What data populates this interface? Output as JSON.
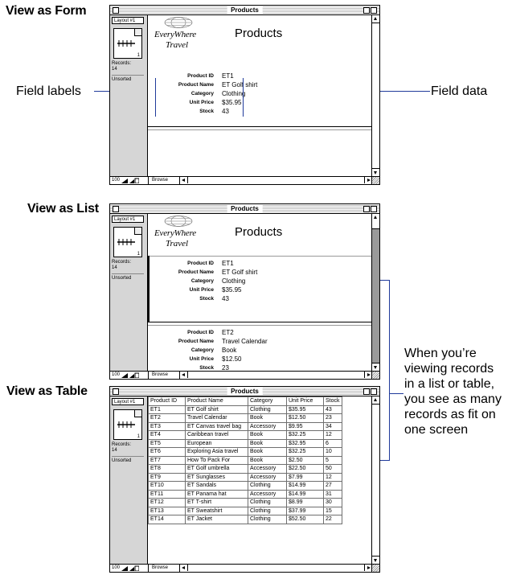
{
  "sections": [
    {
      "heading": "View as Form"
    },
    {
      "heading": "View as List"
    },
    {
      "heading": "View as Table"
    }
  ],
  "callouts": {
    "field_labels": "Field labels",
    "field_data": "Field data",
    "records_note": [
      "When you’re",
      "viewing records",
      "in a list or table,",
      "you see as many",
      "records as fit on",
      "one screen"
    ]
  },
  "window": {
    "title": "Products",
    "layout_popup": "Layout #1",
    "book_page": "1",
    "records_label": "Records:",
    "records_count": "14",
    "sort_status": "Unsorted",
    "zoom_level": "100",
    "mode": "Browse"
  },
  "layout": {
    "logo_line1": "EveryWhere",
    "logo_line2": "Travel",
    "title": "Products"
  },
  "fields": {
    "labels": [
      "Product ID",
      "Product Name",
      "Category",
      "Unit Price",
      "Stock"
    ]
  },
  "records": [
    {
      "id": "ET1",
      "name": "ET Golf shirt",
      "category": "Clothing",
      "price": "$35.95",
      "stock": "43"
    },
    {
      "id": "ET2",
      "name": "Travel Calendar",
      "category": "Book",
      "price": "$12.50",
      "stock": "23"
    },
    {
      "id": "ET3",
      "name": "ET Canvas travel bag",
      "category": "Accessory",
      "price": "$9.95",
      "stock": "34"
    },
    {
      "id": "ET4",
      "name": "Caribbean travel",
      "category": "Book",
      "price": "$32.25",
      "stock": "12"
    },
    {
      "id": "ET5",
      "name": "European",
      "category": "Book",
      "price": "$32.95",
      "stock": "6"
    },
    {
      "id": "ET6",
      "name": "Exploring Asia travel",
      "category": "Book",
      "price": "$32.25",
      "stock": "10"
    },
    {
      "id": "ET7",
      "name": "How To Pack For",
      "category": "Book",
      "price": "$2.50",
      "stock": "5"
    },
    {
      "id": "ET8",
      "name": "ET Golf umbrella",
      "category": "Accessory",
      "price": "$22.50",
      "stock": "50"
    },
    {
      "id": "ET9",
      "name": "ET Sunglasses",
      "category": "Accessory",
      "price": "$7.99",
      "stock": "12"
    },
    {
      "id": "ET10",
      "name": "ET Sandals",
      "category": "Clothing",
      "price": "$14.99",
      "stock": "27"
    },
    {
      "id": "ET11",
      "name": "ET Panama hat",
      "category": "Accessory",
      "price": "$14.99",
      "stock": "31"
    },
    {
      "id": "ET12",
      "name": "ET T-shirt",
      "category": "Clothing",
      "price": "$8.99",
      "stock": "30"
    },
    {
      "id": "ET13",
      "name": "ET Sweatshirt",
      "category": "Clothing",
      "price": "$37.99",
      "stock": "15"
    },
    {
      "id": "ET14",
      "name": "ET Jacket",
      "category": "Clothing",
      "price": "$52.50",
      "stock": "22"
    }
  ],
  "table_headers": [
    "Product ID",
    "Product Name",
    "Category",
    "Unit Price",
    "Stock"
  ],
  "colors": {
    "callout_line": "#1f3a9a",
    "sidebar": "#d6d6d6"
  }
}
